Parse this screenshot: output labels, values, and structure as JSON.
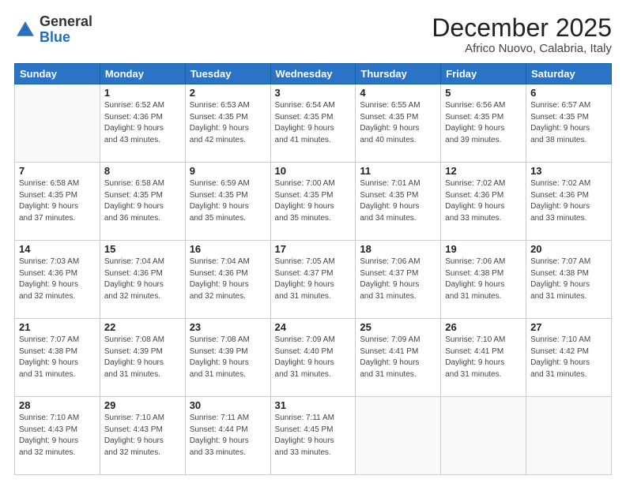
{
  "logo": {
    "general": "General",
    "blue": "Blue"
  },
  "title": "December 2025",
  "subtitle": "Africo Nuovo, Calabria, Italy",
  "weekdays": [
    "Sunday",
    "Monday",
    "Tuesday",
    "Wednesday",
    "Thursday",
    "Friday",
    "Saturday"
  ],
  "weeks": [
    [
      {
        "day": "",
        "sunrise": "",
        "sunset": "",
        "daylight": ""
      },
      {
        "day": "1",
        "sunrise": "Sunrise: 6:52 AM",
        "sunset": "Sunset: 4:36 PM",
        "daylight": "Daylight: 9 hours and 43 minutes."
      },
      {
        "day": "2",
        "sunrise": "Sunrise: 6:53 AM",
        "sunset": "Sunset: 4:35 PM",
        "daylight": "Daylight: 9 hours and 42 minutes."
      },
      {
        "day": "3",
        "sunrise": "Sunrise: 6:54 AM",
        "sunset": "Sunset: 4:35 PM",
        "daylight": "Daylight: 9 hours and 41 minutes."
      },
      {
        "day": "4",
        "sunrise": "Sunrise: 6:55 AM",
        "sunset": "Sunset: 4:35 PM",
        "daylight": "Daylight: 9 hours and 40 minutes."
      },
      {
        "day": "5",
        "sunrise": "Sunrise: 6:56 AM",
        "sunset": "Sunset: 4:35 PM",
        "daylight": "Daylight: 9 hours and 39 minutes."
      },
      {
        "day": "6",
        "sunrise": "Sunrise: 6:57 AM",
        "sunset": "Sunset: 4:35 PM",
        "daylight": "Daylight: 9 hours and 38 minutes."
      }
    ],
    [
      {
        "day": "7",
        "sunrise": "Sunrise: 6:58 AM",
        "sunset": "Sunset: 4:35 PM",
        "daylight": "Daylight: 9 hours and 37 minutes."
      },
      {
        "day": "8",
        "sunrise": "Sunrise: 6:58 AM",
        "sunset": "Sunset: 4:35 PM",
        "daylight": "Daylight: 9 hours and 36 minutes."
      },
      {
        "day": "9",
        "sunrise": "Sunrise: 6:59 AM",
        "sunset": "Sunset: 4:35 PM",
        "daylight": "Daylight: 9 hours and 35 minutes."
      },
      {
        "day": "10",
        "sunrise": "Sunrise: 7:00 AM",
        "sunset": "Sunset: 4:35 PM",
        "daylight": "Daylight: 9 hours and 35 minutes."
      },
      {
        "day": "11",
        "sunrise": "Sunrise: 7:01 AM",
        "sunset": "Sunset: 4:35 PM",
        "daylight": "Daylight: 9 hours and 34 minutes."
      },
      {
        "day": "12",
        "sunrise": "Sunrise: 7:02 AM",
        "sunset": "Sunset: 4:36 PM",
        "daylight": "Daylight: 9 hours and 33 minutes."
      },
      {
        "day": "13",
        "sunrise": "Sunrise: 7:02 AM",
        "sunset": "Sunset: 4:36 PM",
        "daylight": "Daylight: 9 hours and 33 minutes."
      }
    ],
    [
      {
        "day": "14",
        "sunrise": "Sunrise: 7:03 AM",
        "sunset": "Sunset: 4:36 PM",
        "daylight": "Daylight: 9 hours and 32 minutes."
      },
      {
        "day": "15",
        "sunrise": "Sunrise: 7:04 AM",
        "sunset": "Sunset: 4:36 PM",
        "daylight": "Daylight: 9 hours and 32 minutes."
      },
      {
        "day": "16",
        "sunrise": "Sunrise: 7:04 AM",
        "sunset": "Sunset: 4:36 PM",
        "daylight": "Daylight: 9 hours and 32 minutes."
      },
      {
        "day": "17",
        "sunrise": "Sunrise: 7:05 AM",
        "sunset": "Sunset: 4:37 PM",
        "daylight": "Daylight: 9 hours and 31 minutes."
      },
      {
        "day": "18",
        "sunrise": "Sunrise: 7:06 AM",
        "sunset": "Sunset: 4:37 PM",
        "daylight": "Daylight: 9 hours and 31 minutes."
      },
      {
        "day": "19",
        "sunrise": "Sunrise: 7:06 AM",
        "sunset": "Sunset: 4:38 PM",
        "daylight": "Daylight: 9 hours and 31 minutes."
      },
      {
        "day": "20",
        "sunrise": "Sunrise: 7:07 AM",
        "sunset": "Sunset: 4:38 PM",
        "daylight": "Daylight: 9 hours and 31 minutes."
      }
    ],
    [
      {
        "day": "21",
        "sunrise": "Sunrise: 7:07 AM",
        "sunset": "Sunset: 4:38 PM",
        "daylight": "Daylight: 9 hours and 31 minutes."
      },
      {
        "day": "22",
        "sunrise": "Sunrise: 7:08 AM",
        "sunset": "Sunset: 4:39 PM",
        "daylight": "Daylight: 9 hours and 31 minutes."
      },
      {
        "day": "23",
        "sunrise": "Sunrise: 7:08 AM",
        "sunset": "Sunset: 4:39 PM",
        "daylight": "Daylight: 9 hours and 31 minutes."
      },
      {
        "day": "24",
        "sunrise": "Sunrise: 7:09 AM",
        "sunset": "Sunset: 4:40 PM",
        "daylight": "Daylight: 9 hours and 31 minutes."
      },
      {
        "day": "25",
        "sunrise": "Sunrise: 7:09 AM",
        "sunset": "Sunset: 4:41 PM",
        "daylight": "Daylight: 9 hours and 31 minutes."
      },
      {
        "day": "26",
        "sunrise": "Sunrise: 7:10 AM",
        "sunset": "Sunset: 4:41 PM",
        "daylight": "Daylight: 9 hours and 31 minutes."
      },
      {
        "day": "27",
        "sunrise": "Sunrise: 7:10 AM",
        "sunset": "Sunset: 4:42 PM",
        "daylight": "Daylight: 9 hours and 31 minutes."
      }
    ],
    [
      {
        "day": "28",
        "sunrise": "Sunrise: 7:10 AM",
        "sunset": "Sunset: 4:43 PM",
        "daylight": "Daylight: 9 hours and 32 minutes."
      },
      {
        "day": "29",
        "sunrise": "Sunrise: 7:10 AM",
        "sunset": "Sunset: 4:43 PM",
        "daylight": "Daylight: 9 hours and 32 minutes."
      },
      {
        "day": "30",
        "sunrise": "Sunrise: 7:11 AM",
        "sunset": "Sunset: 4:44 PM",
        "daylight": "Daylight: 9 hours and 33 minutes."
      },
      {
        "day": "31",
        "sunrise": "Sunrise: 7:11 AM",
        "sunset": "Sunset: 4:45 PM",
        "daylight": "Daylight: 9 hours and 33 minutes."
      },
      {
        "day": "",
        "sunrise": "",
        "sunset": "",
        "daylight": ""
      },
      {
        "day": "",
        "sunrise": "",
        "sunset": "",
        "daylight": ""
      },
      {
        "day": "",
        "sunrise": "",
        "sunset": "",
        "daylight": ""
      }
    ]
  ]
}
